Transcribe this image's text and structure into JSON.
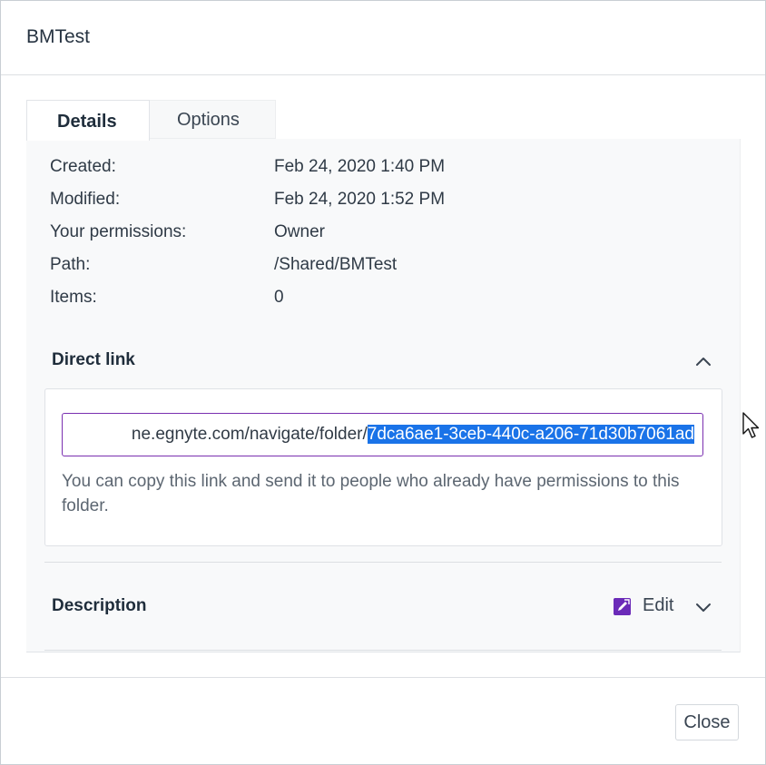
{
  "dialog": {
    "title": "BMTest"
  },
  "tabs": [
    {
      "label": "Details",
      "active": true
    },
    {
      "label": "Options",
      "active": false
    }
  ],
  "properties": [
    {
      "label": "Created:",
      "value": "Feb 24, 2020 1:40 PM"
    },
    {
      "label": "Modified:",
      "value": "Feb 24, 2020 1:52 PM"
    },
    {
      "label": "Your permissions:",
      "value": "Owner"
    },
    {
      "label": "Path:",
      "value": "/Shared/BMTest"
    },
    {
      "label": "Items:",
      "value": "0"
    }
  ],
  "direct_link": {
    "heading": "Direct link",
    "expanded": true,
    "url_visible_prefix": "ne.egnyte.com/navigate/folder/",
    "url_selected_part": "7dca6ae1-3ceb-440c-a206-71d30b7061ad",
    "help_text": "You can copy this link and send it to people who already have permissions to this folder."
  },
  "description": {
    "heading": "Description",
    "edit_label": "Edit",
    "expanded": false
  },
  "footer": {
    "close_label": "Close"
  },
  "colors": {
    "accent_purple": "#6b2bb8",
    "selection_blue": "#1a73e8",
    "panel_bg": "#f8f9fa"
  },
  "icons": {
    "direct_link_toggle": "chevron-up-icon",
    "description_toggle": "chevron-down-icon",
    "edit": "edit-pencil-icon",
    "pointer": "mouse-cursor-icon"
  }
}
